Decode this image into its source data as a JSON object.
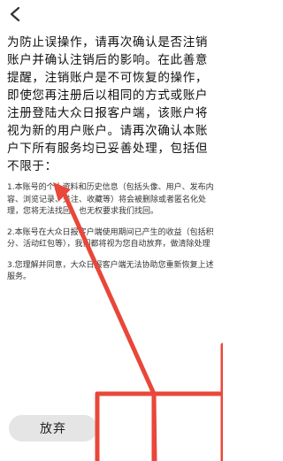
{
  "header": {
    "back_icon": "chevron-left-icon"
  },
  "intro": {
    "text": "为防止误操作，请再次确认是否注销账户并确认注销后的影响。在此善意提醒，注销账户是不可恢复的操作，即使您再注册后以相同的方式或账户注册登陆大众日报客户端，该账户将视为新的用户账户。请再次确认本账户下所有服务均已妥善处理，包括但不限于："
  },
  "clauses": [
    {
      "text": "1.本账号的个人资料和历史信息（包括头像、用户、发布内容、浏览记录、关注、收藏等）将会被删除或者匿名化处理，您将无法找回，也无权要求我们找回。"
    },
    {
      "text": "2.本账号在大众日报客户端使用期间已产生的收益（包括积分、活动红包等），我们都将视为您自动放弃，做清除处理"
    },
    {
      "text": "3.您理解并同意，大众日报客户端无法协助您重新恢复上述服务。"
    }
  ],
  "actions": {
    "give_up_label": "放弃"
  },
  "colors": {
    "annotation_red": "#e8473a",
    "button_bg": "#e5e5e5"
  }
}
